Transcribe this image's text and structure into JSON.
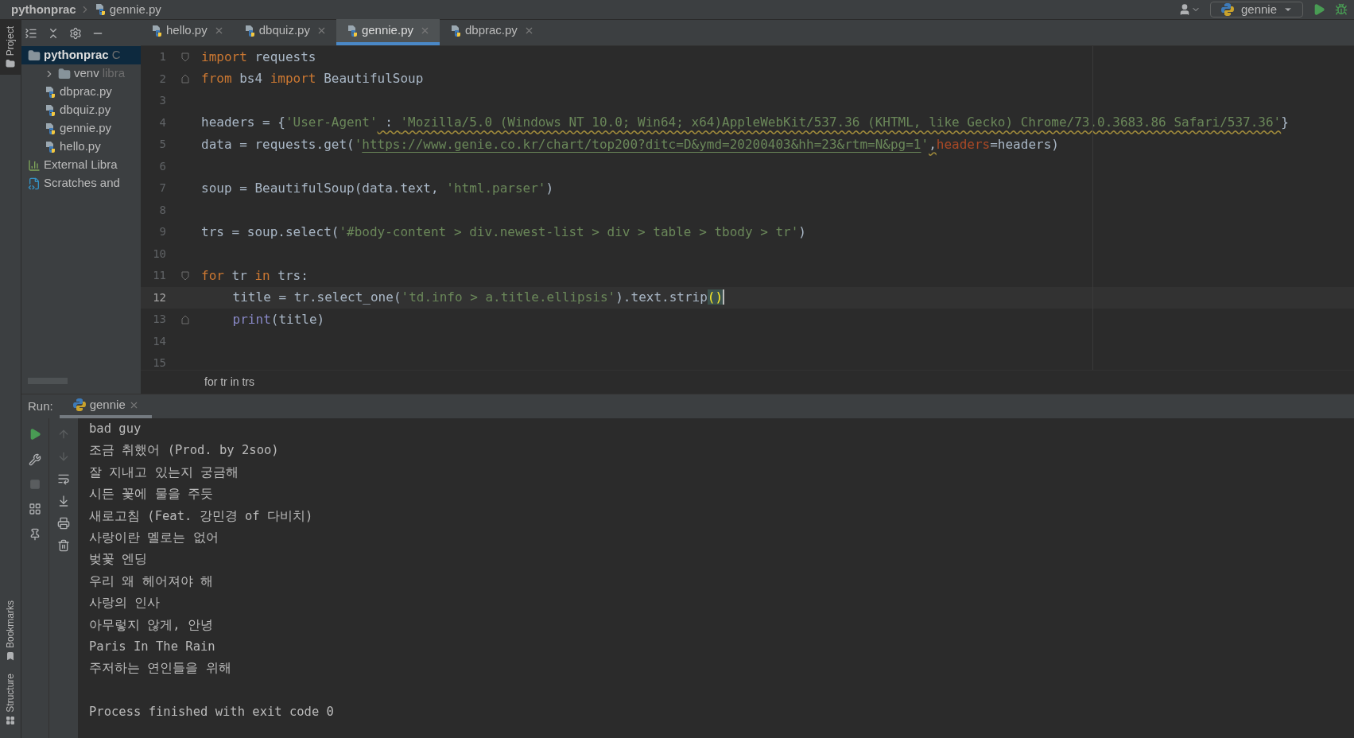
{
  "breadcrumb": [
    "pythonprac",
    "gennie.py"
  ],
  "run_config": {
    "label": "gennie"
  },
  "side_tabs": [
    {
      "label": "Project",
      "selected": true
    }
  ],
  "bottom_side_tabs": [
    {
      "label": "Bookmarks",
      "kind": "bookmark"
    },
    {
      "label": "Structure",
      "kind": "structure"
    }
  ],
  "project_tree": [
    {
      "label": "pythonprac",
      "hint": "C",
      "kind": "folder",
      "expanded": true,
      "selected": true,
      "children": [
        {
          "label": "venv",
          "hint": "libra",
          "kind": "folder",
          "expanded": false,
          "selected": false
        },
        {
          "label": "dbprac.py",
          "kind": "python",
          "selected": false
        },
        {
          "label": "dbquiz.py",
          "kind": "python",
          "selected": false
        },
        {
          "label": "gennie.py",
          "kind": "python",
          "selected": false
        },
        {
          "label": "hello.py",
          "kind": "python",
          "selected": false
        }
      ]
    },
    {
      "label": "External Libra",
      "kind": "library",
      "selected": false
    },
    {
      "label": "Scratches and",
      "kind": "scratch",
      "selected": false
    }
  ],
  "tabs": [
    {
      "label": "hello.py",
      "selected": false
    },
    {
      "label": "dbquiz.py",
      "selected": false
    },
    {
      "label": "gennie.py",
      "selected": true
    },
    {
      "label": "dbprac.py",
      "selected": false
    }
  ],
  "editor": {
    "lines": [
      {
        "number": "1",
        "kind": "fold-start",
        "selected": false,
        "tokens": [
          {
            "kind": "kw",
            "t": "import"
          },
          {
            "kind": "plain",
            "t": " requests"
          }
        ]
      },
      {
        "number": "2",
        "kind": "fold-end",
        "selected": false,
        "tokens": [
          {
            "kind": "kw",
            "t": "from"
          },
          {
            "kind": "plain",
            "t": " bs4 "
          },
          {
            "kind": "kw",
            "t": "import"
          },
          {
            "kind": "plain",
            "t": " BeautifulSoup"
          }
        ]
      },
      {
        "number": "3",
        "kind": "plain",
        "selected": false
      },
      {
        "number": "4",
        "kind": "plain",
        "selected": false,
        "tokens": [
          {
            "kind": "plain",
            "t": "headers = {"
          },
          {
            "kind": "str",
            "t": "'User-Agent'"
          },
          {
            "kind": "warn",
            "t": " : "
          },
          {
            "kind": "warnstr",
            "t": "'Mozilla/5.0 (Windows NT 10.0; Win64; x64)AppleWebKit/537.36 (KHTML, like Gecko) Chrome/73.0.3683.86 Safari/537.36'"
          },
          {
            "kind": "plain",
            "t": "}"
          }
        ]
      },
      {
        "number": "5",
        "kind": "plain",
        "selected": false,
        "tokens": [
          {
            "kind": "plain",
            "t": "data = requests.get("
          },
          {
            "kind": "str",
            "t": "'"
          },
          {
            "kind": "link",
            "t": "https://www.genie.co.kr/chart/top200?ditc=D&ymd=20200403&hh=23&rtm=N&pg=1"
          },
          {
            "kind": "str",
            "t": "'"
          },
          {
            "kind": "warn",
            "t": ","
          },
          {
            "kind": "param",
            "t": "headers"
          },
          {
            "kind": "plain",
            "t": "=headers)"
          }
        ]
      },
      {
        "number": "6",
        "kind": "plain",
        "selected": false
      },
      {
        "number": "7",
        "kind": "plain",
        "selected": false,
        "tokens": [
          {
            "kind": "plain",
            "t": "soup = BeautifulSoup(data.text, "
          },
          {
            "kind": "str",
            "t": "'html.parser'"
          },
          {
            "kind": "plain",
            "t": ")"
          }
        ]
      },
      {
        "number": "8",
        "kind": "plain",
        "selected": false
      },
      {
        "number": "9",
        "kind": "plain",
        "selected": false,
        "tokens": [
          {
            "kind": "plain",
            "t": "trs = soup.select("
          },
          {
            "kind": "str",
            "t": "'#body-content > div.newest-list > div > table > tbody > tr'"
          },
          {
            "kind": "plain",
            "t": ")"
          }
        ]
      },
      {
        "number": "10",
        "kind": "plain",
        "selected": false
      },
      {
        "number": "11",
        "kind": "fold-start",
        "selected": false,
        "tokens": [
          {
            "kind": "kw",
            "t": "for"
          },
          {
            "kind": "plain",
            "t": " tr "
          },
          {
            "kind": "kw",
            "t": "in"
          },
          {
            "kind": "plain",
            "t": " trs:"
          }
        ],
        "children": [
          {
            "number": "12",
            "kind": "plain",
            "selected": true,
            "tokens": [
              {
                "kind": "plain",
                "t": "title = tr.select_one("
              },
              {
                "kind": "str",
                "t": "'td.info > a.title.ellipsis'"
              },
              {
                "kind": "plain",
                "t": ").text.strip"
              },
              {
                "kind": "match",
                "t": "()"
              }
            ]
          },
          {
            "number": "13",
            "kind": "fold-end",
            "selected": false,
            "tokens": [
              {
                "kind": "builtin",
                "t": "print"
              },
              {
                "kind": "plain",
                "t": "(title)"
              }
            ]
          }
        ]
      },
      {
        "number": "14",
        "kind": "plain",
        "selected": false
      },
      {
        "number": "15",
        "kind": "plain",
        "selected": false
      }
    ],
    "context": "for tr in trs"
  },
  "run": {
    "label": "Run:",
    "tab": {
      "label": "gennie",
      "selected": true
    },
    "output": [
      "bad guy",
      "조금 취했어 (Prod. by 2soo)",
      "잘 지내고 있는지 궁금해",
      "시든 꽃에 물을 주듯",
      "새로고침 (Feat. 강민경 of 다비치)",
      "사랑이란 멜로는 없어",
      "벚꽃 엔딩",
      "우리 왜 헤어져야 해",
      "사랑의 인사",
      "아무렇지 않게, 안녕",
      "Paris In The Rain",
      "주저하는 연인들을 위해"
    ],
    "exit_message": "Process finished with exit code 0"
  }
}
